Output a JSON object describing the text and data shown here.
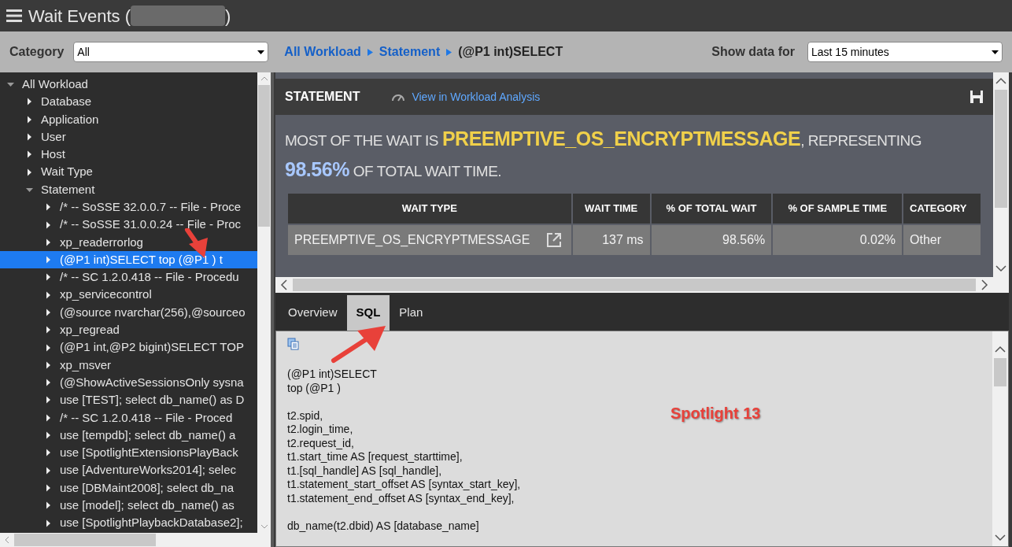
{
  "window": {
    "title_prefix": "Wait Events (",
    "title_suffix": ")"
  },
  "toolbar": {
    "category_label": "Category",
    "category_value": "All",
    "breadcrumb": [
      {
        "text": "All Workload",
        "kind": "link"
      },
      {
        "text": "Statement",
        "kind": "link"
      },
      {
        "text": "(@P1 int)SELECT",
        "kind": "current"
      }
    ],
    "show_label": "Show data for",
    "show_value": "Last 15 minutes"
  },
  "tree": [
    {
      "label": "All Workload",
      "expanded": true,
      "selected": false,
      "children": [
        {
          "label": "Database",
          "expanded": false,
          "selected": false
        },
        {
          "label": "Application",
          "expanded": false,
          "selected": false
        },
        {
          "label": "User",
          "expanded": false,
          "selected": false
        },
        {
          "label": "Host",
          "expanded": false,
          "selected": false
        },
        {
          "label": "Wait Type",
          "expanded": false,
          "selected": false
        },
        {
          "label": "Statement",
          "expanded": true,
          "selected": false,
          "children": [
            {
              "label": "/*   -- SoSSE 32.0.0.7 -- File - Proce",
              "expanded": false,
              "selected": false
            },
            {
              "label": "/*   -- SoSSE 31.0.0.24 -- File - Proc",
              "expanded": false,
              "selected": false
            },
            {
              "label": "xp_readerrorlog",
              "expanded": false,
              "selected": false
            },
            {
              "label": "(@P1 int)SELECT    top (@P1 )     t",
              "expanded": false,
              "selected": true
            },
            {
              "label": "/*  -- SC 1.2.0.418 -- File - Procedu",
              "expanded": false,
              "selected": false
            },
            {
              "label": "xp_servicecontrol",
              "expanded": false,
              "selected": false
            },
            {
              "label": "(@source nvarchar(256),@sourceo",
              "expanded": false,
              "selected": false
            },
            {
              "label": "xp_regread",
              "expanded": false,
              "selected": false
            },
            {
              "label": "(@P1 int,@P2 bigint)SELECT  TOP",
              "expanded": false,
              "selected": false
            },
            {
              "label": "xp_msver",
              "expanded": false,
              "selected": false
            },
            {
              "label": "(@ShowActiveSessionsOnly sysna",
              "expanded": false,
              "selected": false
            },
            {
              "label": "use [TEST];   select db_name() as D",
              "expanded": false,
              "selected": false
            },
            {
              "label": "/*   -- SC 1.2.0.418 -- File - Proced",
              "expanded": false,
              "selected": false
            },
            {
              "label": "use [tempdb];   select db_name() a",
              "expanded": false,
              "selected": false
            },
            {
              "label": "use [SpotlightExtensionsPlayBack",
              "expanded": false,
              "selected": false
            },
            {
              "label": "use [AdventureWorks2014];   selec",
              "expanded": false,
              "selected": false
            },
            {
              "label": "use [DBMaint2008];   select db_na",
              "expanded": false,
              "selected": false
            },
            {
              "label": "use [model];   select db_name() as",
              "expanded": false,
              "selected": false
            },
            {
              "label": "use [SpotlightPlaybackDatabase2];",
              "expanded": false,
              "selected": false
            }
          ]
        }
      ]
    }
  ],
  "statement": {
    "title": "STATEMENT",
    "link": "View in Workload Analysis",
    "summary": [
      {
        "text": "MOST OF THE WAIT IS ",
        "kind": "plain"
      },
      {
        "text": "PREEMPTIVE_OS_ENCRYPTMESSAGE",
        "kind": "wait"
      },
      {
        "text": ", REPRESENTING ",
        "kind": "plain"
      },
      {
        "text": "98.56%",
        "kind": "percent"
      },
      {
        "text": " OF TOTAL WAIT TIME.",
        "kind": "plain"
      }
    ],
    "table": {
      "columns": [
        "WAIT TYPE",
        "WAIT TIME",
        "% OF TOTAL WAIT",
        "% OF SAMPLE TIME",
        "CATEGORY"
      ],
      "rows": [
        [
          "PREEMPTIVE_OS_ENCRYPTMESSAGE",
          "137 ms",
          "98.56%",
          "0.02%",
          "Other"
        ]
      ]
    }
  },
  "tabs": [
    {
      "label": "Overview",
      "selected": false
    },
    {
      "label": "SQL",
      "selected": true
    },
    {
      "label": "Plan",
      "selected": false
    }
  ],
  "sql_blocks": [
    [
      "(@P1 int)SELECT",
      "top (@P1 )"
    ],
    [
      "t2.spid,",
      "t2.login_time,",
      "t2.request_id,",
      "t1.start_time AS [request_starttime],",
      "t1.[sql_handle] AS [sql_handle],",
      "t1.statement_start_offset AS [syntax_start_key],",
      "t1.statement_end_offset AS [syntax_end_key],"
    ],
    [
      "db_name(t2.dbid) AS [database_name]"
    ]
  ],
  "annotation": {
    "label": "Spotlight 13"
  }
}
